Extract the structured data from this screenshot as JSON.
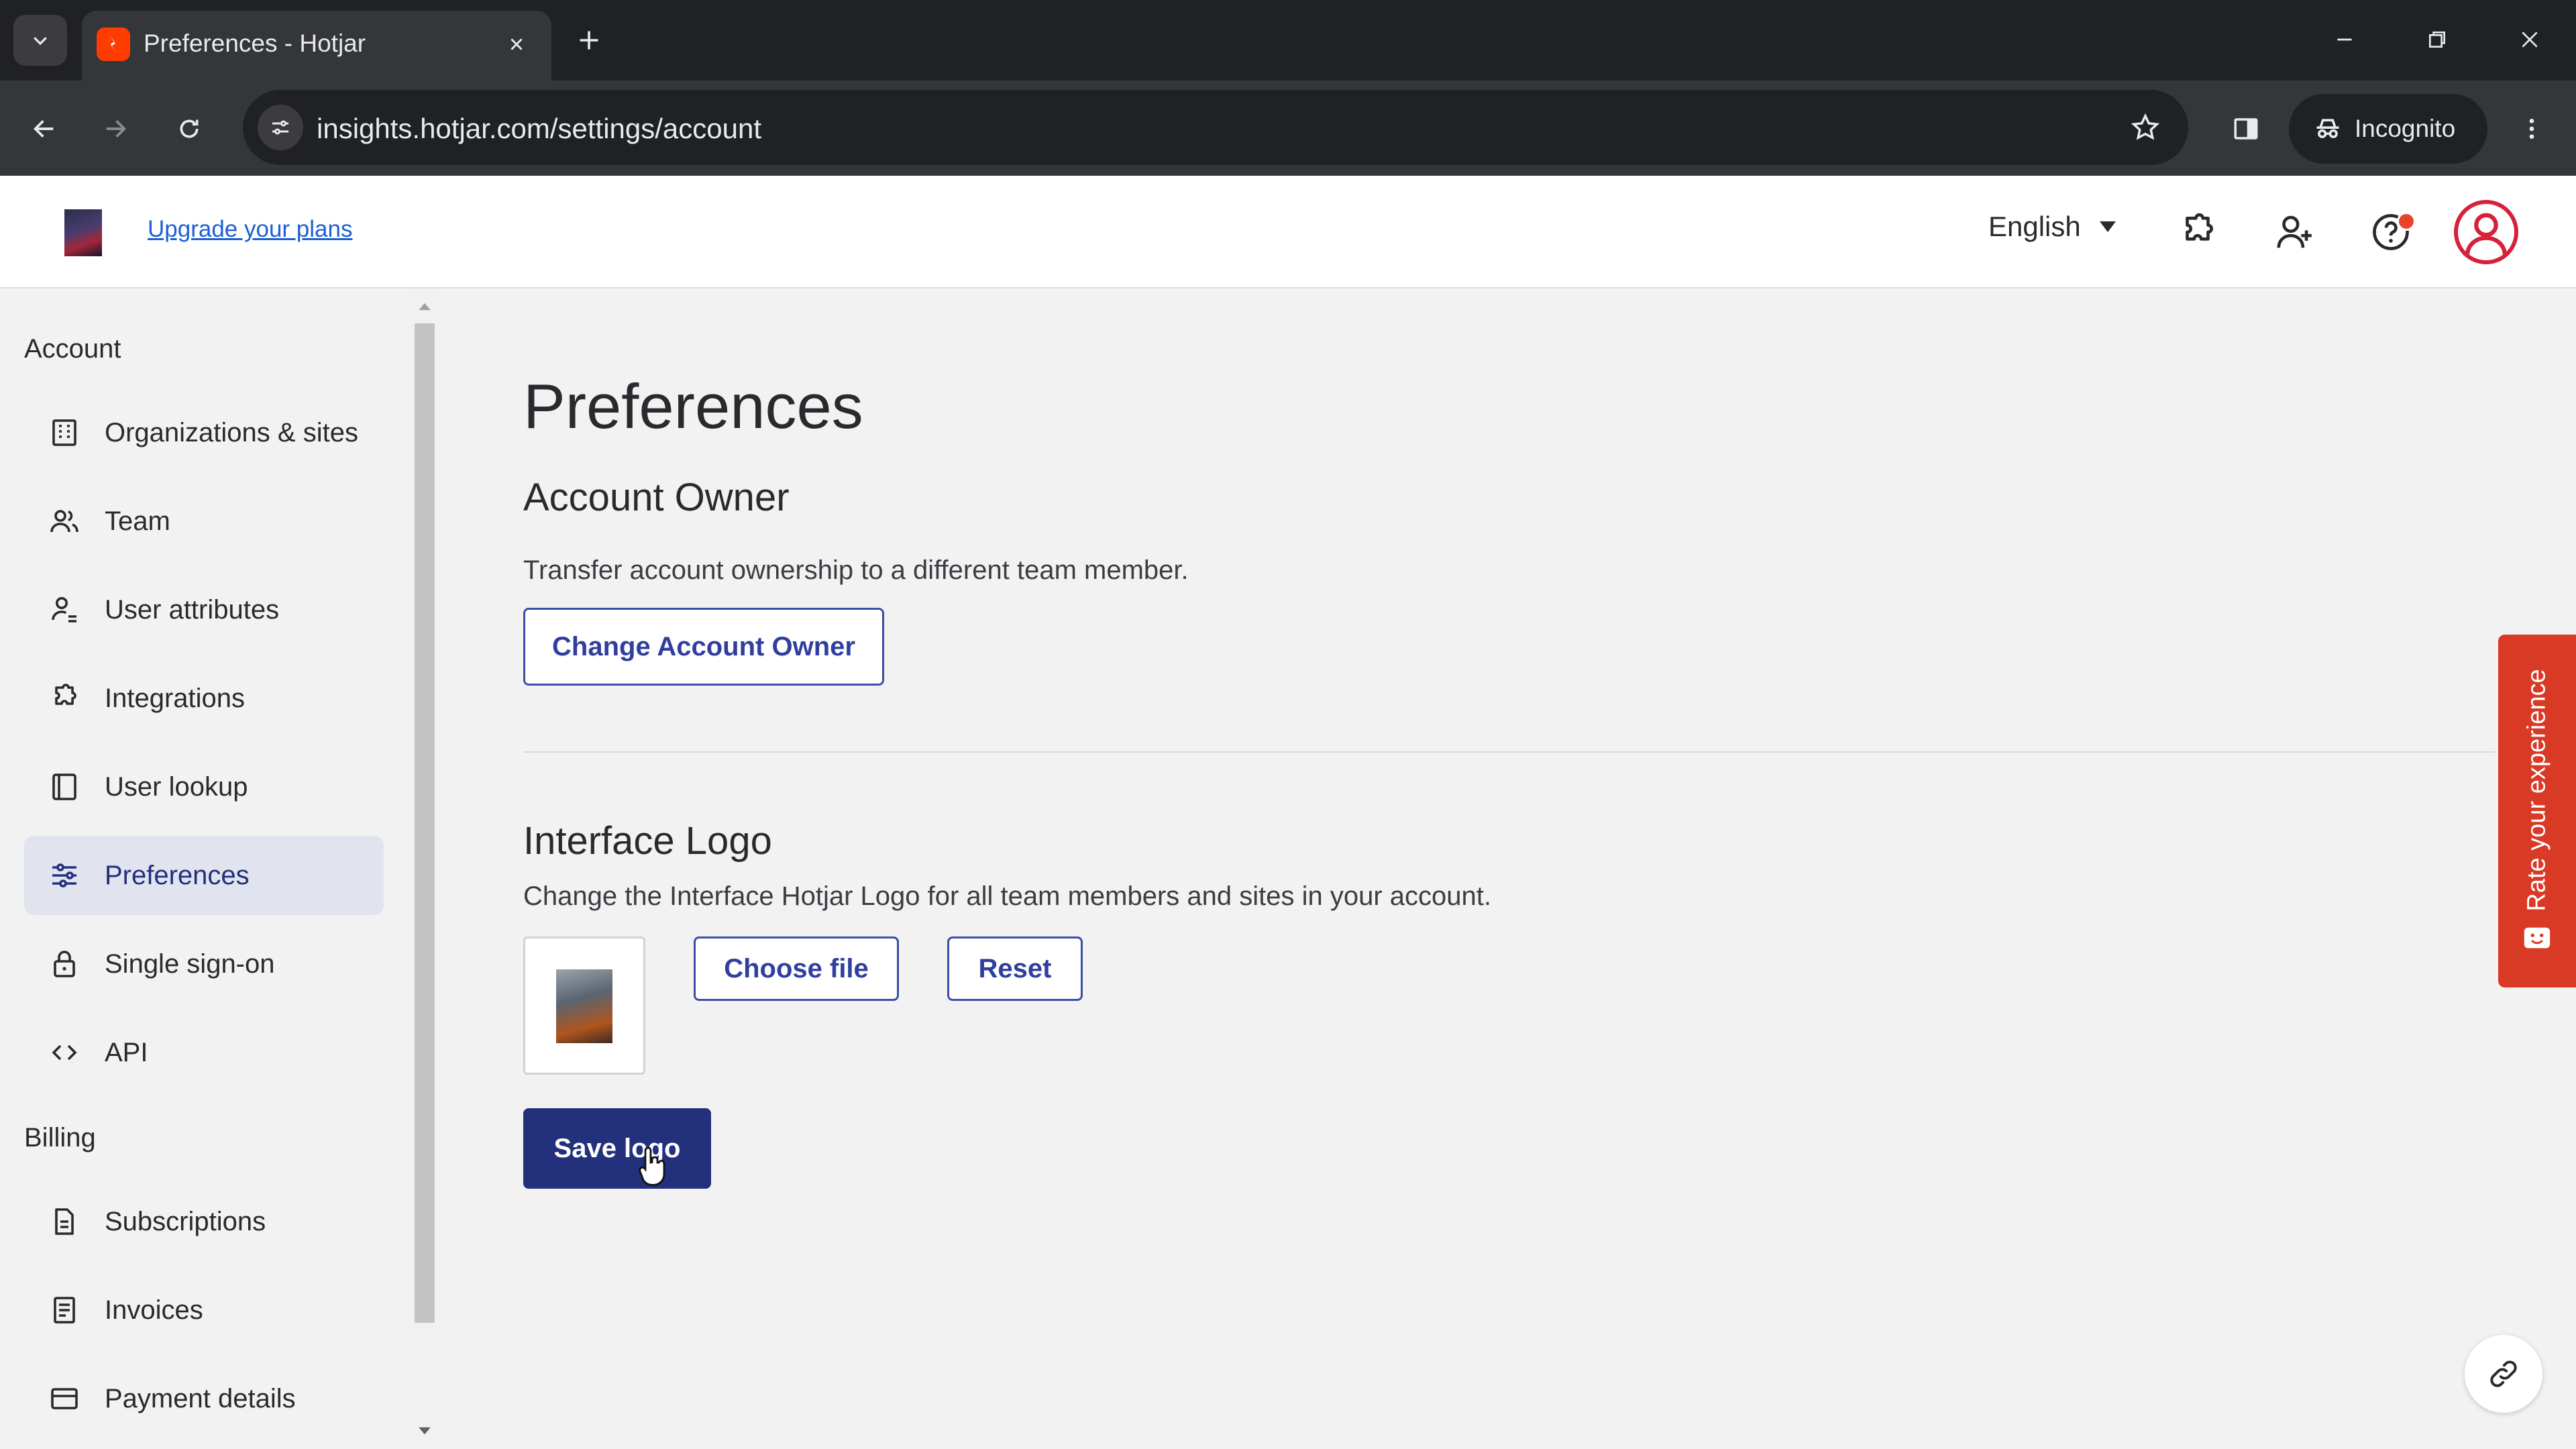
{
  "browser": {
    "tab_title": "Preferences - Hotjar",
    "url": "insights.hotjar.com/settings/account",
    "incognito_label": "Incognito"
  },
  "header": {
    "upgrade_link": "Upgrade your plans",
    "language": "English",
    "icons": [
      "puzzle-icon",
      "add-user-icon",
      "help-icon",
      "avatar"
    ]
  },
  "sidebar": {
    "account_heading": "Account",
    "account_items": [
      {
        "label": "Organizations & sites",
        "icon": "building-icon"
      },
      {
        "label": "Team",
        "icon": "team-icon"
      },
      {
        "label": "User attributes",
        "icon": "user-attributes-icon"
      },
      {
        "label": "Integrations",
        "icon": "puzzle-icon"
      },
      {
        "label": "User lookup",
        "icon": "user-lookup-icon"
      },
      {
        "label": "Preferences",
        "icon": "sliders-icon",
        "active": true
      },
      {
        "label": "Single sign-on",
        "icon": "lock-icon"
      },
      {
        "label": "API",
        "icon": "code-icon"
      }
    ],
    "billing_heading": "Billing",
    "billing_items": [
      {
        "label": "Subscriptions",
        "icon": "document-icon"
      },
      {
        "label": "Invoices",
        "icon": "receipt-icon"
      },
      {
        "label": "Payment details",
        "icon": "credit-card-icon"
      }
    ]
  },
  "main": {
    "title": "Preferences",
    "account_owner": {
      "heading": "Account Owner",
      "description": "Transfer account ownership to a different team member.",
      "button": "Change Account Owner"
    },
    "interface_logo": {
      "heading": "Interface Logo",
      "description": "Change the Interface Hotjar Logo for all team members and sites in your account.",
      "choose_button": "Choose file",
      "reset_button": "Reset",
      "save_button": "Save logo"
    }
  },
  "feedback": {
    "label": "Rate your experience"
  },
  "colors": {
    "primary": "#23307c",
    "feedback": "#d93a25",
    "link": "#1d5fd6"
  }
}
